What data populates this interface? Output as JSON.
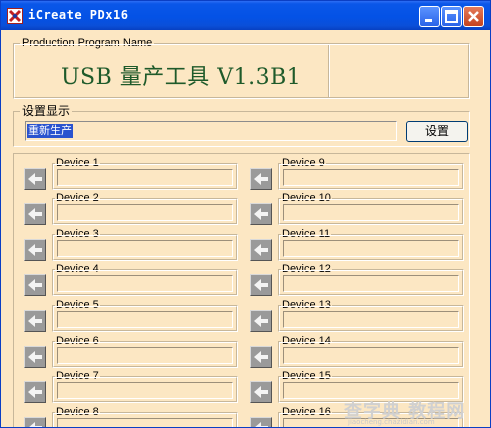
{
  "window": {
    "title": "iCreate PDx16",
    "icon": "app-icon",
    "buttons": [
      "minimize-icon",
      "maximize-icon",
      "close-icon"
    ]
  },
  "program": {
    "legend": "Production Program Name",
    "name": "USB 量产工具 V1.3B1"
  },
  "settings": {
    "legend": "设置显示",
    "status": "重新生产",
    "button_label": "设置"
  },
  "devices": {
    "left": [
      {
        "label": "Device 1"
      },
      {
        "label": "Device 2"
      },
      {
        "label": "Device 3"
      },
      {
        "label": "Device 4"
      },
      {
        "label": "Device 5"
      },
      {
        "label": "Device 6"
      },
      {
        "label": "Device 7"
      },
      {
        "label": "Device 8"
      }
    ],
    "right": [
      {
        "label": "Device 9"
      },
      {
        "label": "Device 10"
      },
      {
        "label": "Device 11"
      },
      {
        "label": "Device 12"
      },
      {
        "label": "Device 13"
      },
      {
        "label": "Device 14"
      },
      {
        "label": "Device 15"
      },
      {
        "label": "Device 16"
      }
    ]
  },
  "watermark": {
    "text": "查字典 教程网",
    "url": "jiaocheng.chazidian.com"
  },
  "colors": {
    "window_bg": "#fce7c3",
    "titlebar": "#0452e6",
    "program_name": "#1e5a2a",
    "selection": "#2a53cf"
  }
}
